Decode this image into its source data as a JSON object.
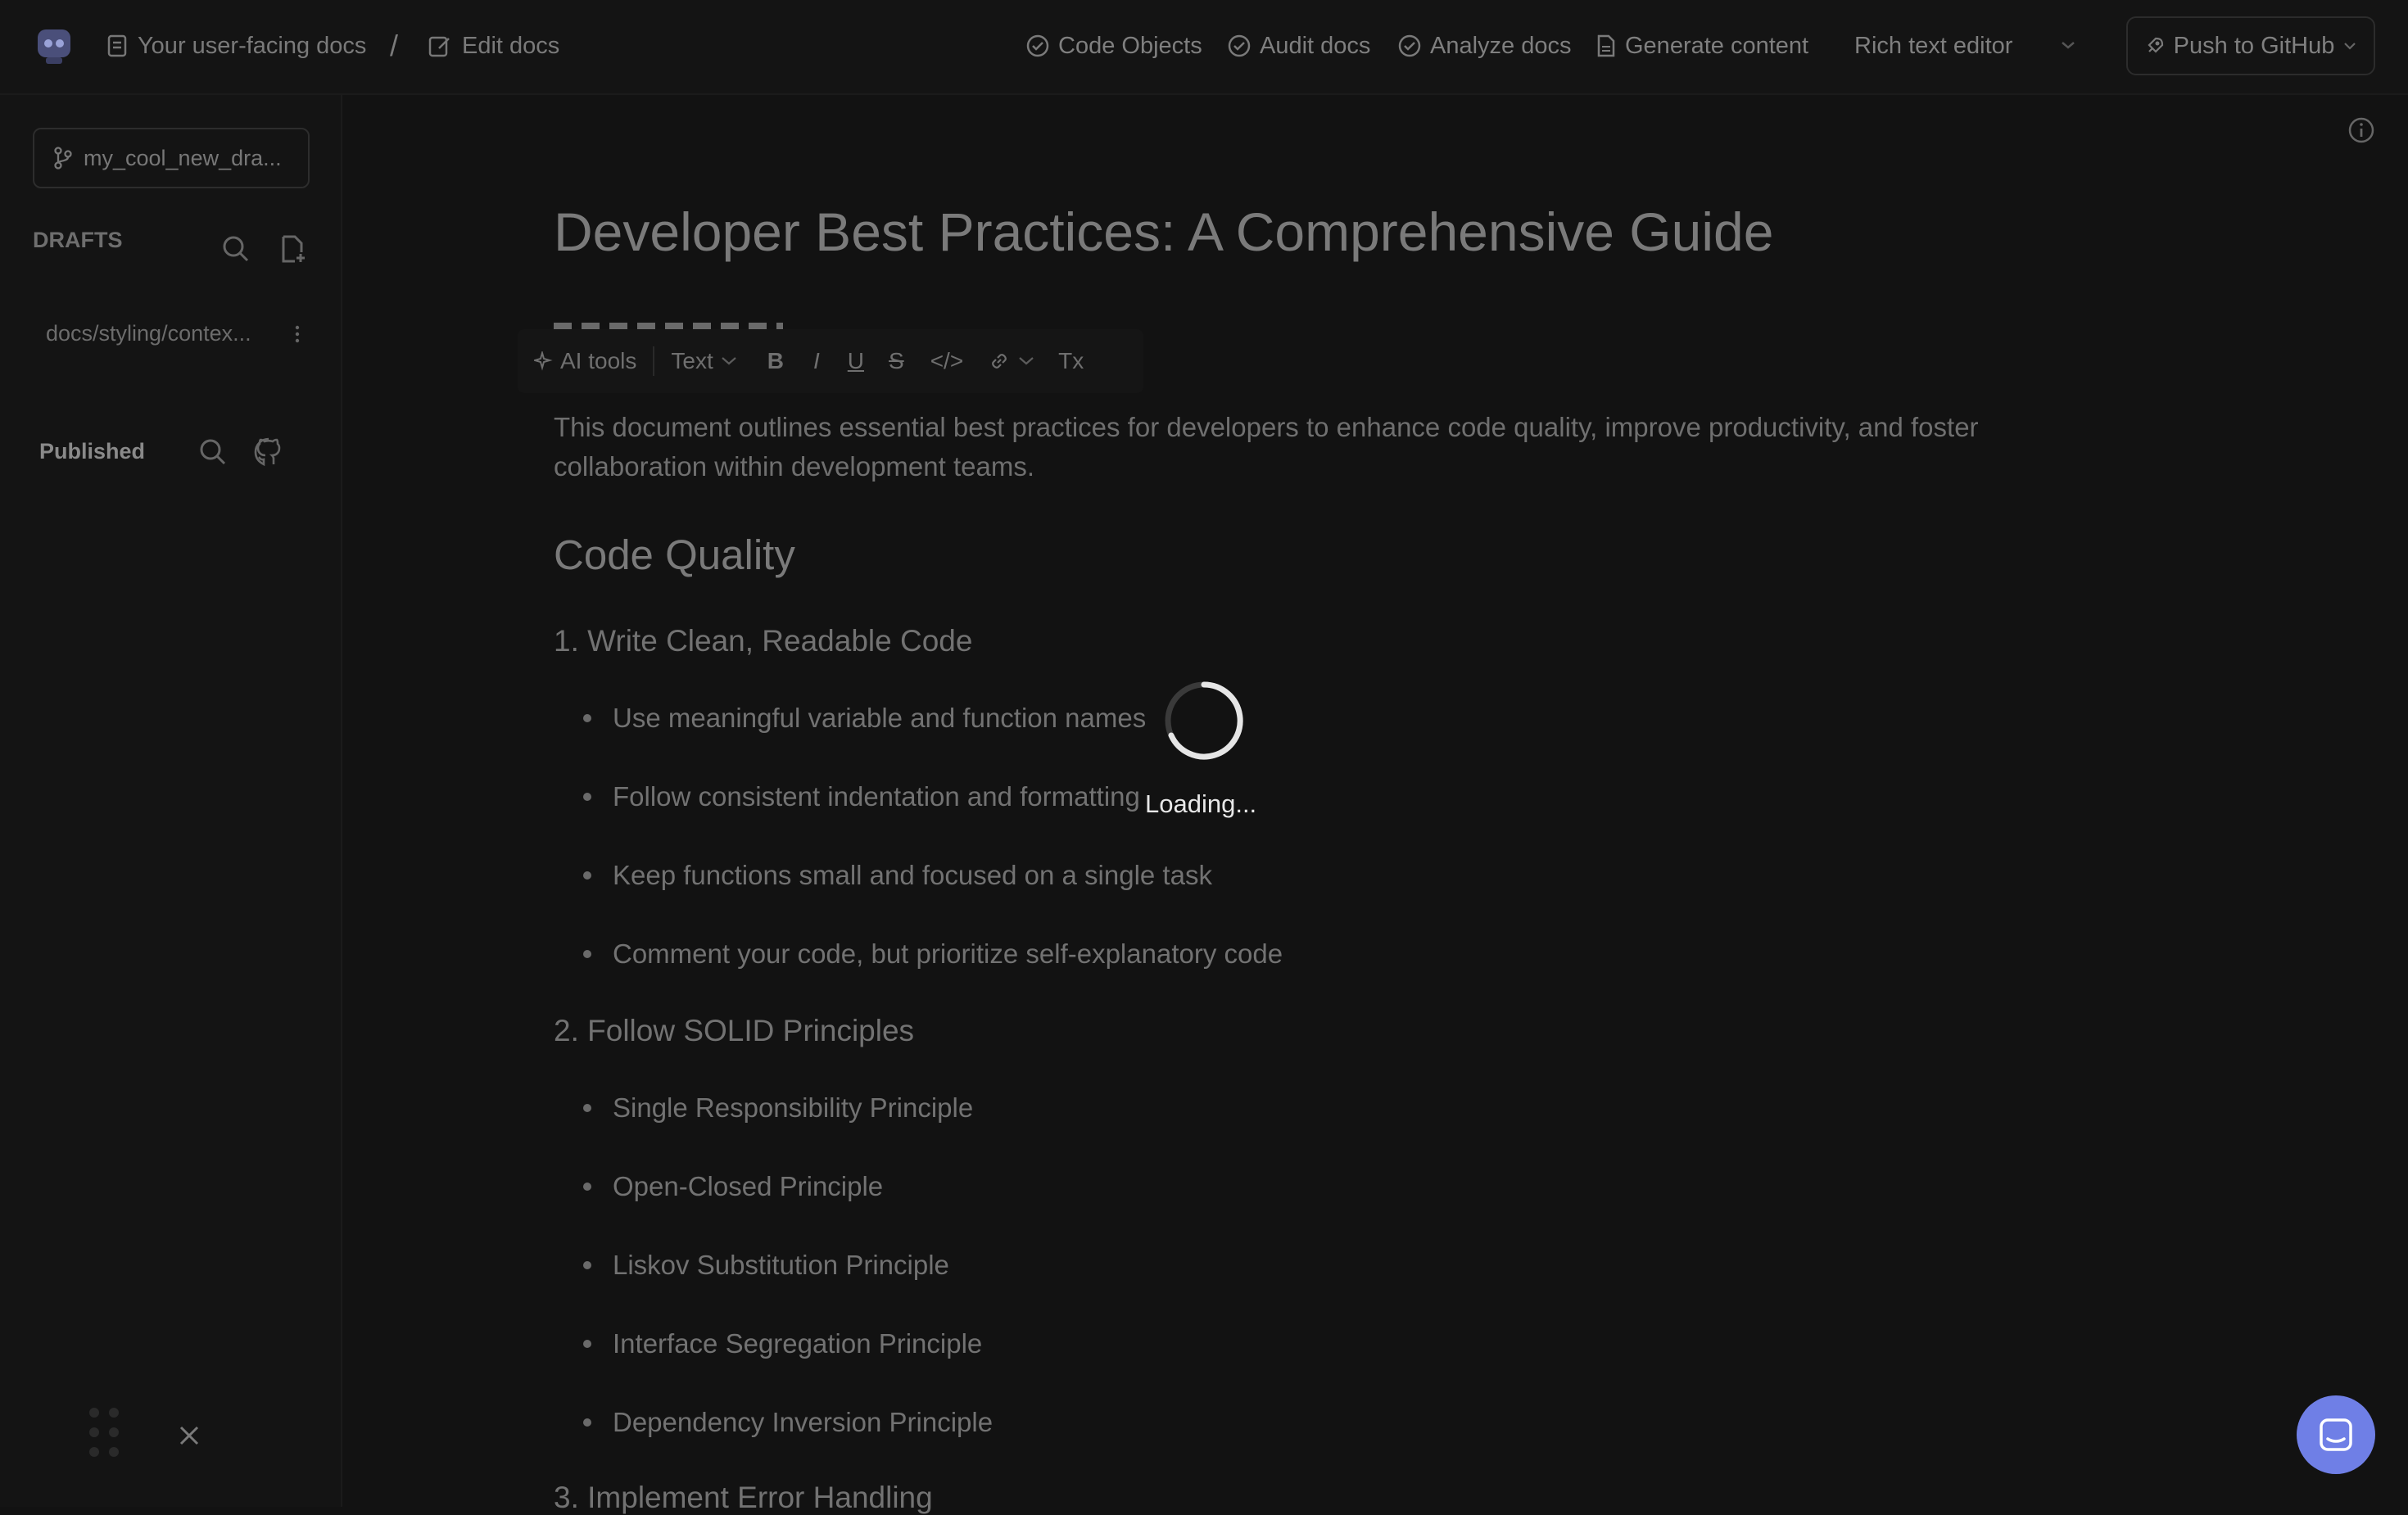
{
  "header": {
    "breadcrumb": [
      "Your user-facing docs",
      "/",
      "Edit docs"
    ],
    "nav": [
      "Code Objects",
      "Audit docs",
      "Analyze docs",
      "Generate content"
    ],
    "editor_mode": "Rich text editor",
    "push_label": "Push to GitHub"
  },
  "sidebar": {
    "branch": "my_cool_new_dra...",
    "drafts_heading": "DRAFTS",
    "draft_items": [
      "docs/styling/contex..."
    ],
    "published_heading": "Published"
  },
  "toolbar": {
    "ai_tools": "AI tools",
    "text_style": "Text",
    "bold": "B",
    "italic": "I",
    "underline": "U",
    "strike": "S",
    "code": "</>",
    "clear": "Tx"
  },
  "document": {
    "title": "Developer Best Practices: A Comprehensive Guide",
    "intro": "This document outlines essential best practices for developers to enhance code quality, improve productivity, and foster collaboration within development teams.",
    "section_heading": "Code Quality",
    "sub1": "1. Write Clean, Readable Code",
    "sub1_items": [
      "Use meaningful variable and function names",
      "Follow consistent indentation and formatting",
      "Keep functions small and focused on a single task",
      "Comment your code, but prioritize self-explanatory code"
    ],
    "sub2": "2. Follow SOLID Principles",
    "sub2_items": [
      "Single Responsibility Principle",
      "Open-Closed Principle",
      "Liskov Substitution Principle",
      "Interface Segregation Principle",
      "Dependency Inversion Principle"
    ],
    "sub3": "3. Implement Error Handling"
  },
  "overlay": {
    "loading": "Loading..."
  },
  "colors": {
    "accent": "#6f7fe6",
    "background": "#121212"
  }
}
